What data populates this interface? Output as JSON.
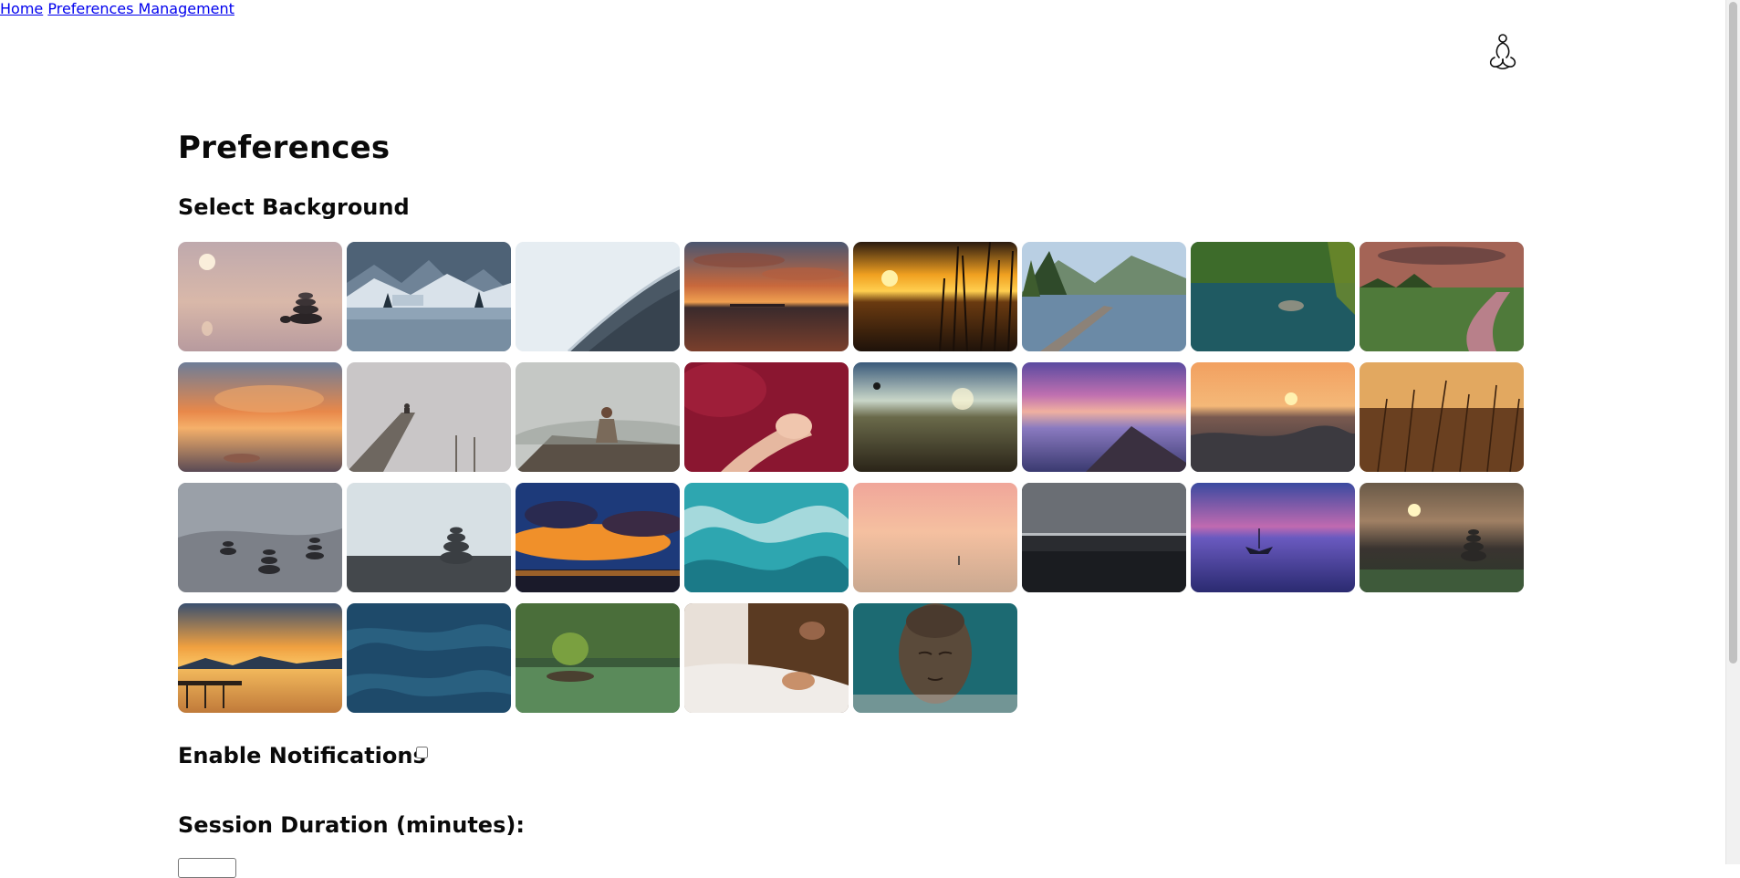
{
  "nav": {
    "home": "Home",
    "prefs": "Preferences Management"
  },
  "logo": {
    "icon": "meditation-figure-icon"
  },
  "page_title": "Preferences",
  "background_section": {
    "title": "Select Background",
    "images": [
      "stone-cairn-misty-sunrise",
      "snowy-mountain-lake-cabin",
      "frozen-ice-water-edge",
      "orange-cloud-sunset-lake",
      "reeds-sunset-silhouette",
      "alpine-lake-wooden-pier",
      "green-lake-forest-rock",
      "river-meadow-dusk",
      "golden-cloud-sunset-sea",
      "foggy-pier-meditating-person",
      "woman-meditating-misty-rock",
      "hands-red-robe-meditation",
      "wheat-field-hot-air-balloon",
      "purple-sky-above-clouds",
      "sunset-ocean-wave",
      "golden-grass-sunlight",
      "stacked-stones-rock",
      "pebble-cairn-fog",
      "dramatic-blue-orange-sky",
      "turquoise-ocean-waves",
      "peach-sky-paddleboarder",
      "dark-cloudy-lake",
      "violet-lake-boat",
      "sun-stone-cairn-bokeh",
      "sunset-pier-mountains",
      "deep-blue-sea-waves",
      "forest-lake-island-tree",
      "meditation-mudra-hands",
      "bronze-buddha-face"
    ]
  },
  "notifications": {
    "label": "Enable Notifications",
    "checked": false
  },
  "session_duration": {
    "label": "Session Duration (minutes):"
  }
}
